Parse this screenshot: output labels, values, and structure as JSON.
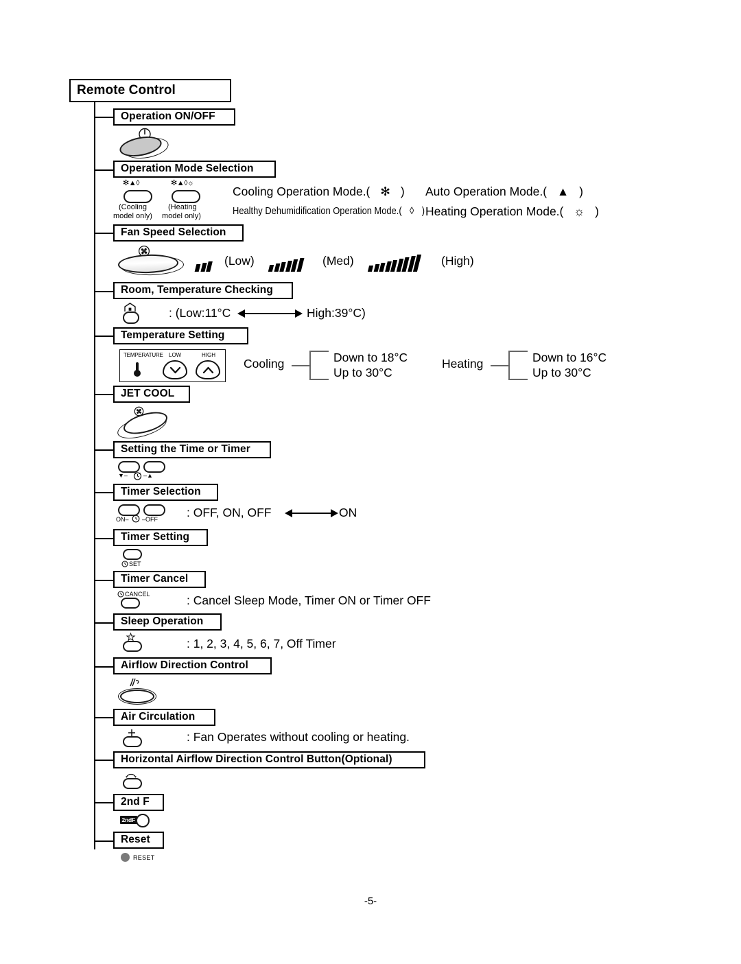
{
  "document": {
    "title": "Remote Control",
    "page_number": "-5-"
  },
  "sections": [
    {
      "id": "operation-on-off",
      "heading": "Operation ON/OFF",
      "button_icon": "power-icon"
    },
    {
      "id": "operation-mode-selection",
      "heading": "Operation Mode Selection",
      "buttons": [
        {
          "icons": "✻▲◊",
          "caption_line1": "(Cooling",
          "caption_line2": "model only)"
        },
        {
          "icons": "✻▲◊☼",
          "caption_line1": "(Heating",
          "caption_line2": "model only)"
        }
      ],
      "modes": [
        {
          "label": "Cooling Operation Mode.(",
          "symbol": "✻",
          "close": ")",
          "size": "normal"
        },
        {
          "label": "Auto Operation Mode.(",
          "symbol": "▲",
          "close": ")",
          "size": "normal"
        },
        {
          "label": "Healthy Dehumidification Operation Mode.(",
          "symbol": "◊",
          "close": ")",
          "size": "small"
        },
        {
          "label": "Heating Operation Mode.(",
          "symbol": "☼",
          "close": ")",
          "size": "normal"
        }
      ]
    },
    {
      "id": "fan-speed-selection",
      "heading": "Fan Speed Selection",
      "button_icon": "fan-icon",
      "speeds": [
        {
          "label": "(Low)",
          "bars": 3
        },
        {
          "label": "(Med)",
          "bars": 6
        },
        {
          "label": "(High)",
          "bars": 9
        }
      ]
    },
    {
      "id": "room-temperature-checking",
      "heading": "Room, Temperature Checking",
      "button_icon": "room-icon",
      "range_text_left": ": (Low:11°C",
      "range_text_right": "High:39°C)"
    },
    {
      "id": "temperature-setting",
      "heading": "Temperature Setting",
      "panel": {
        "label": "TEMPERATURE",
        "low_label": "LOW",
        "high_label": "HIGH",
        "down_icon": "chevron-down-icon",
        "up_icon": "chevron-up-icon",
        "thermometer_icon": "thermometer-icon"
      },
      "ranges": [
        {
          "mode": "Cooling",
          "down": "Down to 18°C",
          "up": "Up to 30°C"
        },
        {
          "mode": "Heating",
          "down": "Down to 16°C",
          "up": "Up to 30°C"
        }
      ]
    },
    {
      "id": "jet-cool",
      "heading": "JET COOL",
      "button_icon": "jet-fan-icon"
    },
    {
      "id": "setting-the-time-or-timer",
      "heading": "Setting the Time or Timer",
      "glyph_left": "▼–",
      "glyph_clock": "clock-icon",
      "glyph_right": "–▲"
    },
    {
      "id": "timer-selection",
      "heading": "Timer Selection",
      "glyph_left": "ON–",
      "glyph_clock": "clock-icon",
      "glyph_right": "–OFF",
      "sequence_left": ": OFF, ON, OFF",
      "sequence_right": "ON"
    },
    {
      "id": "timer-setting",
      "heading": "Timer Setting",
      "glyph": "SET",
      "glyph_clock": "clock-icon"
    },
    {
      "id": "timer-cancel",
      "heading": "Timer Cancel",
      "glyph": "CANCEL",
      "glyph_clock": "clock-icon",
      "description": ": Cancel Sleep Mode, Timer ON or Timer OFF"
    },
    {
      "id": "sleep-operation",
      "heading": "Sleep Operation",
      "button_icon": "star-icon",
      "description": ": 1, 2, 3, 4, 5, 6, 7,  Off Timer"
    },
    {
      "id": "airflow-direction-control",
      "heading": "Airflow Direction Control",
      "button_icon": "vertical-vane-icon"
    },
    {
      "id": "air-circulation",
      "heading": "Air Circulation",
      "button_icon": "plus-icon",
      "description": ": Fan Operates without cooling or heating."
    },
    {
      "id": "horizontal-airflow-direction-control",
      "heading": "Horizontal Airflow Direction Control Button(Optional)",
      "button_icon": "horizontal-vane-icon"
    },
    {
      "id": "second-function",
      "heading": "2nd F",
      "badge": "2ndF"
    },
    {
      "id": "reset",
      "heading": "Reset",
      "label": "RESET",
      "dot_icon": "reset-dot-icon"
    }
  ]
}
